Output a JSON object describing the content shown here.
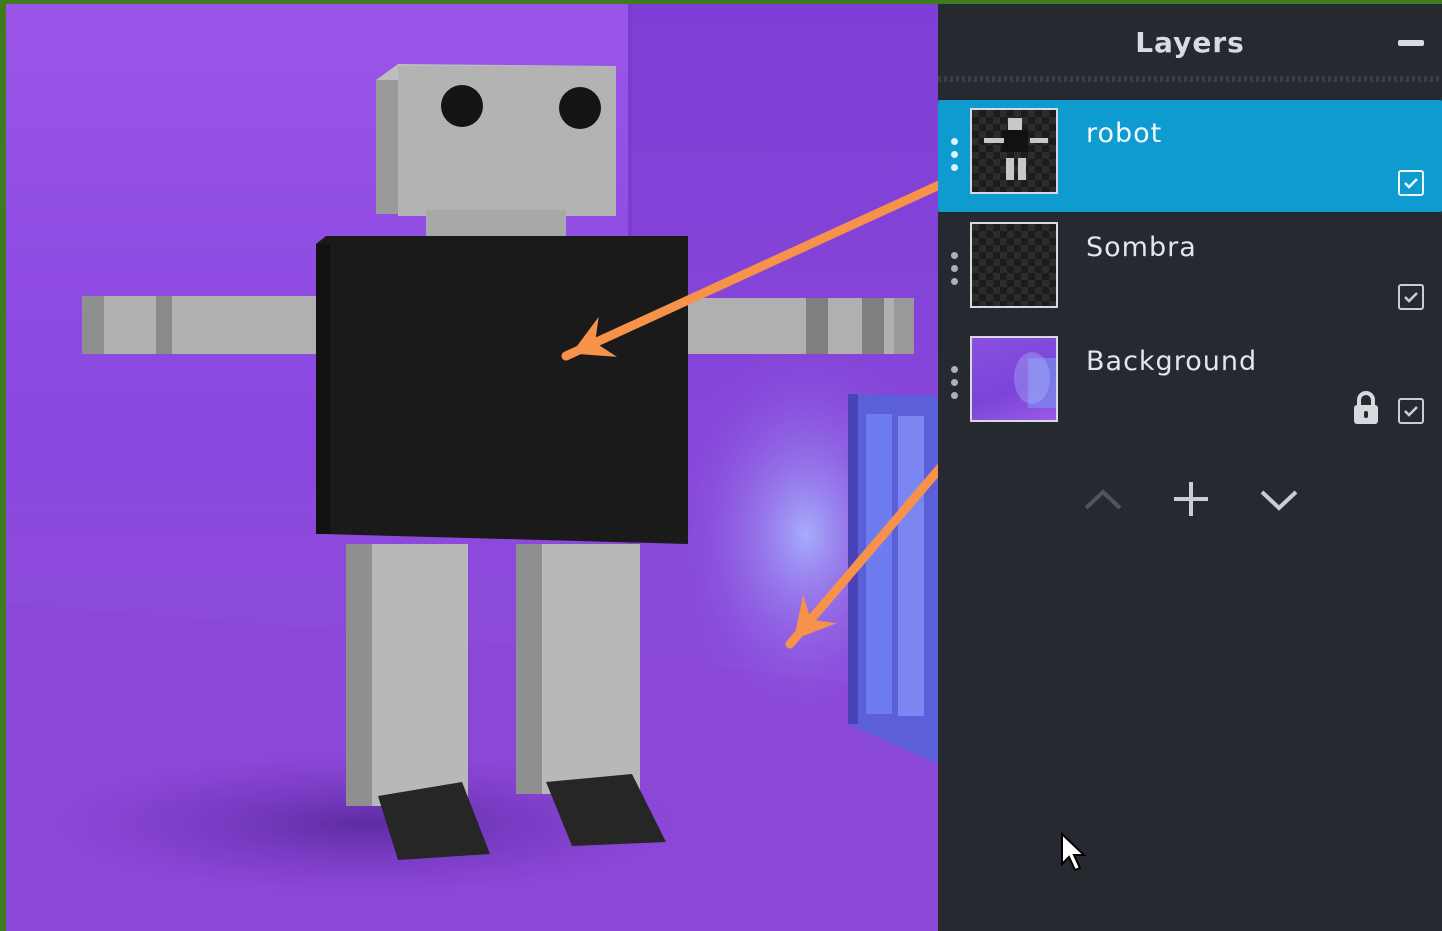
{
  "panel": {
    "title": "Layers",
    "layers": [
      {
        "name": "robot",
        "selected": true,
        "visible": true,
        "locked": false
      },
      {
        "name": "Sombra",
        "selected": false,
        "visible": true,
        "locked": false
      },
      {
        "name": "Background",
        "selected": false,
        "visible": true,
        "locked": true
      }
    ],
    "actions": [
      "move-layer-up",
      "add-layer",
      "move-layer-down"
    ]
  },
  "colors": {
    "selected_row": "#0d9bd0",
    "panel_bg": "#262a30",
    "annotation_arrow": "#f7924a",
    "canvas_purple": "#8a48e0"
  }
}
